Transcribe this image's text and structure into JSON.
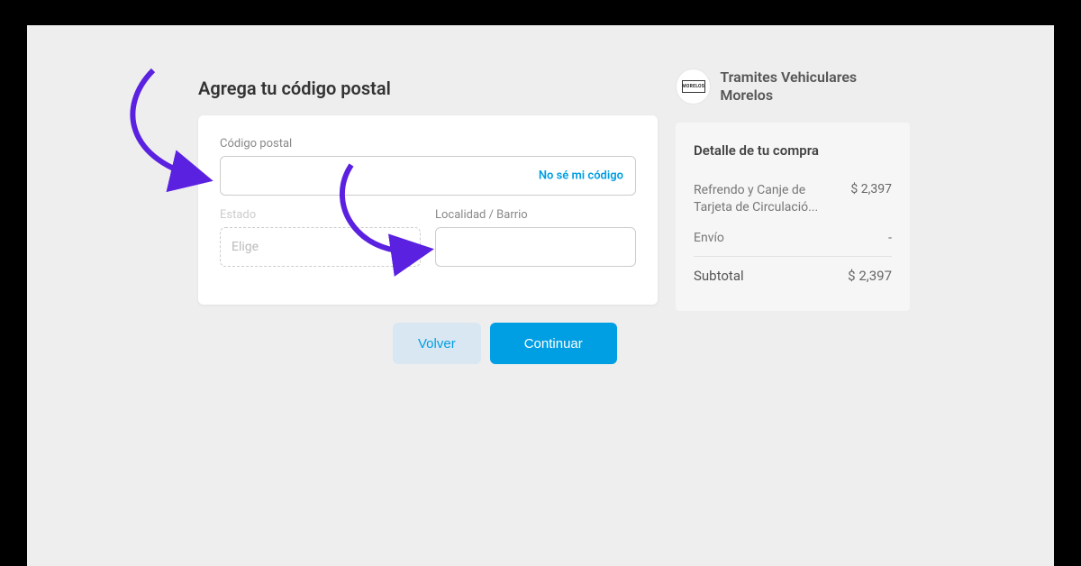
{
  "title": "Agrega tu código postal",
  "form": {
    "postal_label": "Código postal",
    "postal_link": "No sé mi código",
    "state_label": "Estado",
    "state_placeholder": "Elige",
    "locality_label": "Localidad / Barrio"
  },
  "buttons": {
    "back": "Volver",
    "continue": "Continuar"
  },
  "merchant": {
    "name": "Tramites Vehiculares Morelos",
    "logo_text": "MORELOS"
  },
  "summary": {
    "title": "Detalle de tu compra",
    "item_name": "Refrendo y Canje de Tarjeta de Circulació...",
    "item_price": "$ 2,397",
    "shipping_label": "Envío",
    "shipping_value": "-",
    "subtotal_label": "Subtotal",
    "subtotal_value": "$ 2,397"
  }
}
